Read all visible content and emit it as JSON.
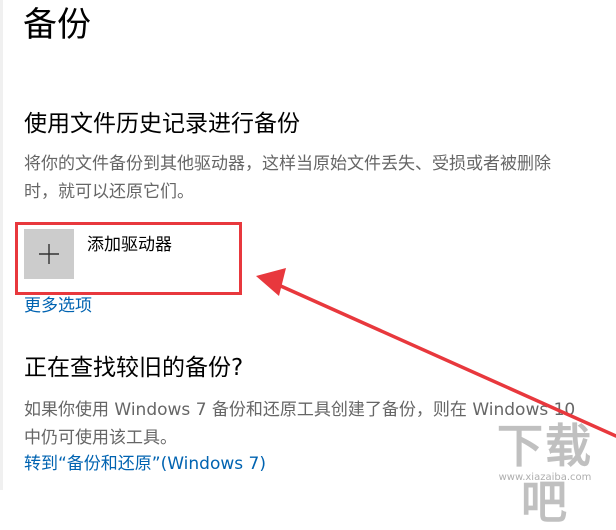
{
  "page": {
    "title": "备份"
  },
  "file_history": {
    "heading": "使用文件历史记录进行备份",
    "description": "将你的文件备份到其他驱动器，这样当原始文件丢失、受损或者被删除时，就可以还原它们。",
    "add_drive_label": "添加驱动器",
    "more_options_link": "更多选项"
  },
  "older_backup": {
    "heading": "正在查找较旧的备份?",
    "description": "如果你使用 Windows 7 备份和还原工具创建了备份，则在 Windows 10 中仍可使用该工具。",
    "restore_link": "转到“备份和还原”(Windows 7)"
  },
  "watermark": {
    "text": "下载吧",
    "sub": "www.xiazaiba.com"
  },
  "colors": {
    "link": "#0063b1",
    "annotation": "#e8383d",
    "tile": "#cccccc",
    "secondary_text": "#666666"
  },
  "icons": {
    "add": "plus-icon"
  }
}
